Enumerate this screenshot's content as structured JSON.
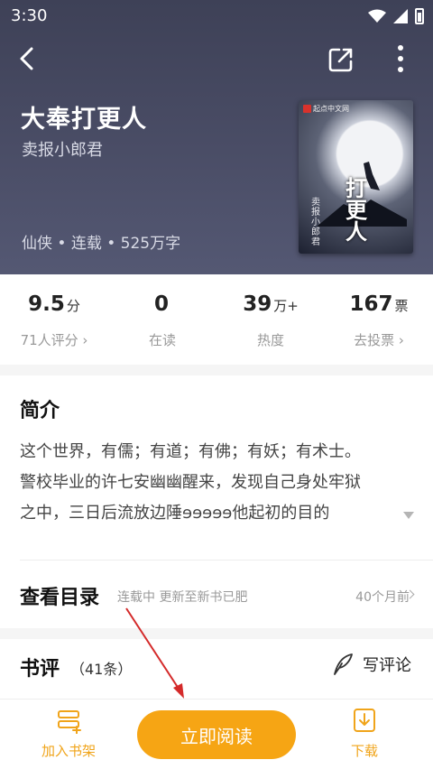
{
  "status_bar": {
    "time": "3:30"
  },
  "book": {
    "title": "大奉打更人",
    "author": "卖报小郎君",
    "meta": "仙侠 • 连载 • 525万字",
    "cover": {
      "publisher": "起点中文网",
      "title_text": "打更人",
      "author_text": "卖报小郎君"
    }
  },
  "stats": [
    {
      "value": "9.5",
      "unit": "分",
      "label": "71人评分 ›"
    },
    {
      "value": "0",
      "unit": "",
      "label": "在读"
    },
    {
      "value": "39",
      "unit": "万+",
      "label": "热度"
    },
    {
      "value": "167",
      "unit": "票",
      "label": "去投票 ›"
    }
  ],
  "intro": {
    "heading": "简介",
    "lines": [
      "这个世界，有儒；有道；有佛；有妖；有术士。",
      "警校毕业的许七安幽幽醒来，发现自己身处牢狱",
      "之中，三日后流放边陲ɘɘɘɘɘ他起初的目的"
    ]
  },
  "catalog": {
    "heading": "查看目录",
    "status": "连载中 更新至新书已肥",
    "updated": "40个月前"
  },
  "reviews": {
    "heading": "书评",
    "count": "（41条）",
    "write_label": "写评论"
  },
  "bottom_bar": {
    "add_shelf": "加入书架",
    "read_now": "立即阅读",
    "download": "下载"
  },
  "colors": {
    "accent": "#f6a514",
    "header_bg": "#45485f",
    "annotation_arrow": "#d42a2a"
  },
  "icons": [
    "back-icon",
    "share-icon",
    "more-icon",
    "chevron-right-icon",
    "pen-icon",
    "bookshelf-icon",
    "download-icon",
    "wifi-icon",
    "signal-icon",
    "battery-icon"
  ]
}
